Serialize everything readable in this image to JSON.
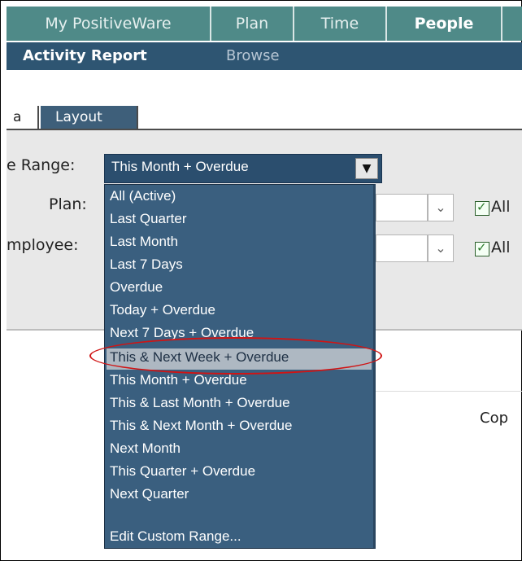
{
  "topnav": {
    "tabs": [
      {
        "label": "My PositiveWare"
      },
      {
        "label": "Plan"
      },
      {
        "label": "Time"
      },
      {
        "label": "People"
      }
    ]
  },
  "subnav": {
    "items": [
      {
        "label": "Activity Report"
      },
      {
        "label": "Browse"
      }
    ]
  },
  "tabs": {
    "partial": "a",
    "layout": "Layout"
  },
  "form": {
    "range_label": "e Range:",
    "range_value": "This Month + Overdue",
    "plan_label": "Plan:",
    "employee_label": "mployee:",
    "all_label": "All",
    "all_label_2": "All"
  },
  "dropdown": {
    "options": [
      "All (Active)",
      "Last Quarter",
      "Last Month",
      "Last 7 Days",
      "Overdue",
      "Today + Overdue",
      "Next 7 Days + Overdue",
      "This & Next Week + Overdue",
      "This Month + Overdue",
      "This & Last Month + Overdue",
      "This & Next Month + Overdue",
      "Next Month",
      "This Quarter + Overdue",
      "Next Quarter",
      "Edit Custom Range..."
    ],
    "highlighted": "This & Next Week + Overdue"
  },
  "footer": {
    "text": "Cop"
  },
  "colors": {
    "nav_green": "#4f8a88",
    "nav_blue": "#2e5572",
    "dropdown_bg": "#3a5f7f",
    "highlight": "#aeb8c2",
    "annotation": "#d01414"
  }
}
